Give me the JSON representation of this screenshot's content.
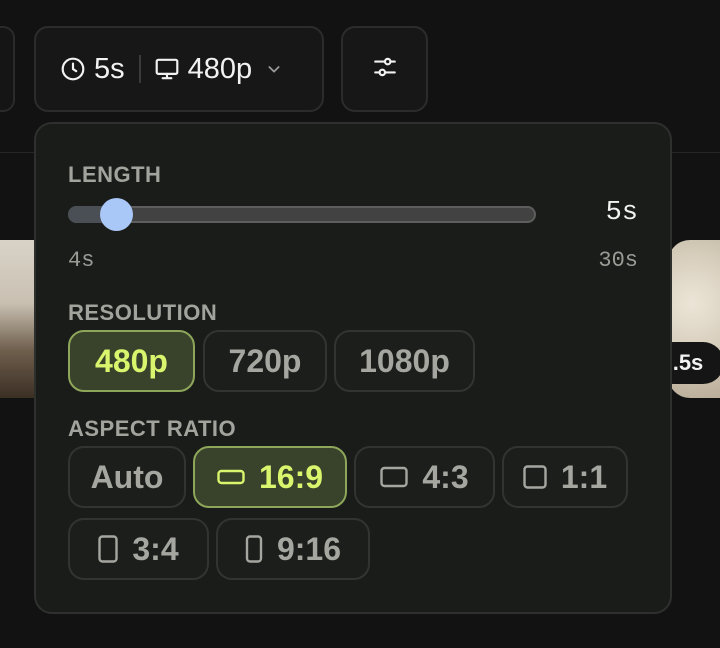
{
  "toolbar": {
    "duration": "5s",
    "resolution": "480p"
  },
  "background": {
    "badge": ".5s"
  },
  "popover": {
    "length": {
      "label": "LENGTH",
      "value": "5s",
      "min_label": "4s",
      "max_label": "30s",
      "min": 4,
      "max": 30,
      "current": 5
    },
    "resolution": {
      "label": "RESOLUTION",
      "options": [
        "480p",
        "720p",
        "1080p"
      ],
      "selected": "480p"
    },
    "aspect_ratio": {
      "label": "ASPECT RATIO",
      "options": [
        "Auto",
        "16:9",
        "4:3",
        "1:1",
        "3:4",
        "9:16"
      ],
      "selected": "16:9"
    }
  },
  "colors": {
    "accent_green": "#d9f56d",
    "slider_thumb": "#a9c7f7",
    "background": "#121212"
  }
}
